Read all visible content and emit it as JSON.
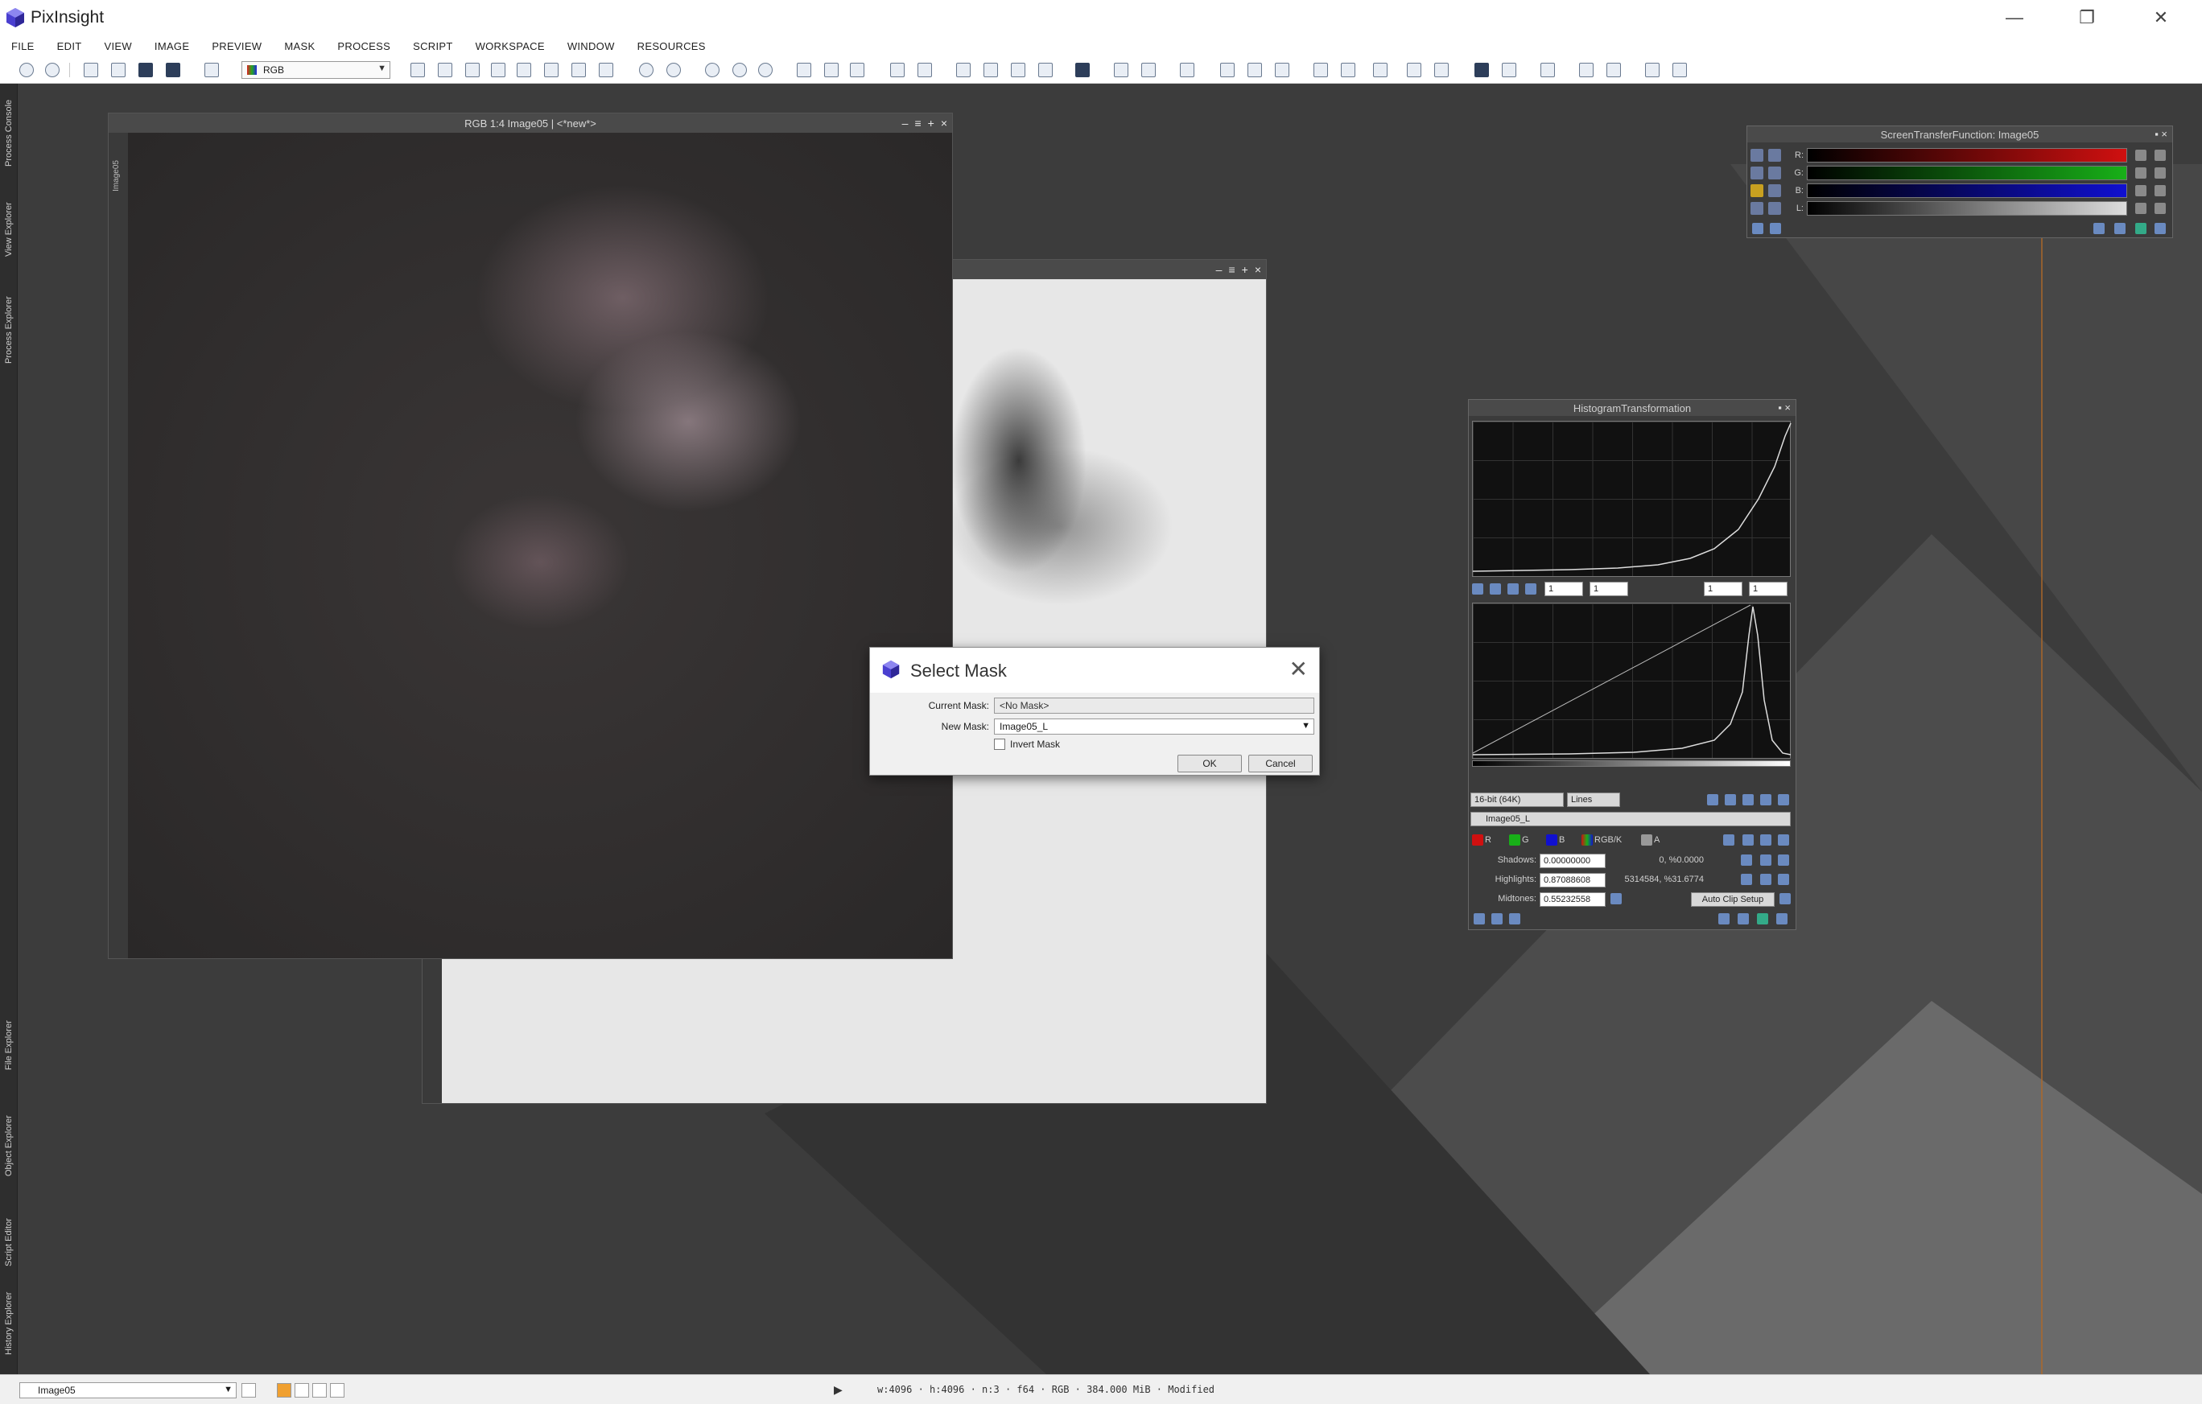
{
  "app": {
    "title": "PixInsight"
  },
  "window_controls": {
    "minimize": "—",
    "restore": "❐",
    "close": "✕"
  },
  "menu": [
    "FILE",
    "EDIT",
    "VIEW",
    "IMAGE",
    "PREVIEW",
    "MASK",
    "PROCESS",
    "SCRIPT",
    "WORKSPACE",
    "WINDOW",
    "RESOURCES"
  ],
  "toolbar": {
    "color_space": "RGB"
  },
  "left_dock": {
    "top_tabs": [
      "Process Console",
      "View Explorer",
      "Process Explorer"
    ],
    "bottom_tabs": [
      "File Explorer",
      "Object Explorer",
      "Script Editor",
      "History Explorer"
    ]
  },
  "image_window_main": {
    "title": "RGB 1:4 Image05 | <*new*>",
    "side_label": "Image05"
  },
  "stf_panel": {
    "title": "ScreenTransferFunction: Image05",
    "channels": [
      "R:",
      "G:",
      "B:",
      "L:"
    ]
  },
  "ht_panel": {
    "title": "HistogramTransformation",
    "zoom_fields": [
      "1",
      "1",
      "1",
      "1"
    ],
    "resolution": "16-bit (64K)",
    "graph_style": "Lines",
    "view": "Image05_L",
    "channels": [
      "R",
      "G",
      "B",
      "RGB/K",
      "A"
    ],
    "shadows_label": "Shadows:",
    "shadows_value": "0.00000000",
    "shadows_stats": "0, %0.0000",
    "highlights_label": "Highlights:",
    "highlights_value": "0.87088608",
    "highlights_stats": "5314584, %31.6774",
    "midtones_label": "Midtones:",
    "midtones_value": "0.55232558",
    "auto_clip": "Auto Clip Setup"
  },
  "dialog": {
    "title": "Select Mask",
    "current_mask_label": "Current Mask:",
    "current_mask_value": "<No Mask>",
    "new_mask_label": "New Mask:",
    "new_mask_value": "Image05_L",
    "invert_label": "Invert Mask",
    "invert_checked": false,
    "ok_label": "OK",
    "cancel_label": "Cancel"
  },
  "statusbar": {
    "view": "Image05",
    "info": "w:4096 · h:4096 · n:3 · f64 · RGB · 384.000 MiB · Modified"
  },
  "colors": {
    "accent": "#5b4fd6",
    "workspace": "#3c3c3c",
    "guide": "#b06a28"
  }
}
